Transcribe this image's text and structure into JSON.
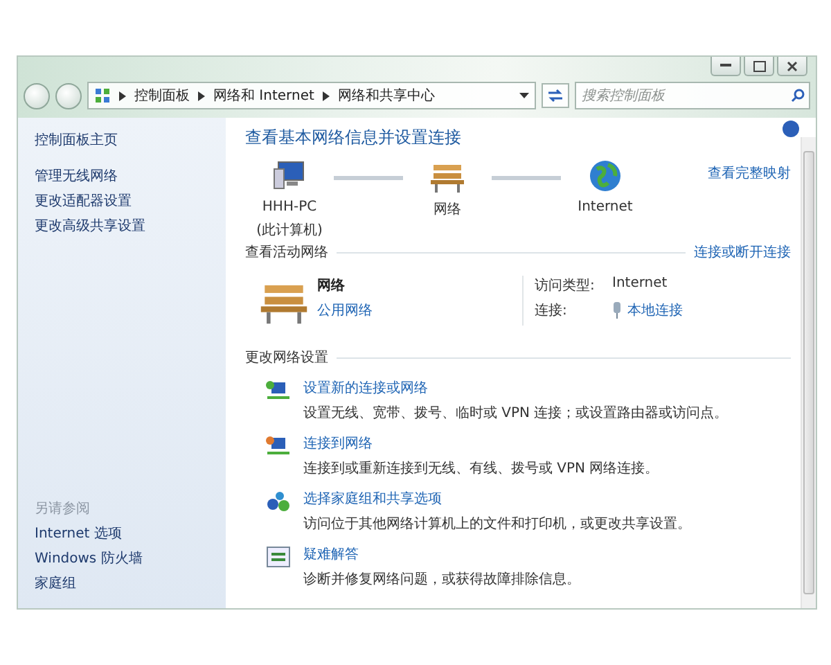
{
  "address_bar": {
    "crumbs": [
      "控制面板",
      "网络和 Internet",
      "网络和共享中心"
    ]
  },
  "search": {
    "placeholder": "搜索控制面板"
  },
  "sidebar": {
    "home": "控制面板主页",
    "links": [
      "管理无线网络",
      "更改适配器设置",
      "更改高级共享设置"
    ],
    "see_also_title": "另请参阅",
    "see_also": [
      "Internet 选项",
      "Windows 防火墙",
      "家庭组"
    ]
  },
  "main": {
    "title": "查看基本网络信息并设置连接",
    "map_link": "查看完整映射",
    "map_nodes": [
      {
        "kind": "computer",
        "label": "HHH-PC",
        "sublabel": "(此计算机)"
      },
      {
        "kind": "network",
        "label": "网络"
      },
      {
        "kind": "internet",
        "label": "Internet"
      }
    ],
    "active_section": {
      "heading": "查看活动网络",
      "link": "连接或断开连接",
      "network_name": "网络",
      "network_type": "公用网络",
      "access_label": "访问类型:",
      "access_value": "Internet",
      "connection_label": "连接:",
      "connection_value": "本地连接"
    },
    "settings_section": {
      "heading": "更改网络设置",
      "tasks": [
        {
          "kind": "new-connection",
          "title": "设置新的连接或网络",
          "description": "设置无线、宽带、拨号、临时或 VPN 连接；或设置路由器或访问点。"
        },
        {
          "kind": "connect",
          "title": "连接到网络",
          "description": "连接到或重新连接到无线、有线、拨号或 VPN 网络连接。"
        },
        {
          "kind": "homegroup",
          "title": "选择家庭组和共享选项",
          "description": "访问位于其他网络计算机上的文件和打印机，或更改共享设置。"
        },
        {
          "kind": "troubleshoot",
          "title": "疑难解答",
          "description": "诊断并修复网络问题，或获得故障排除信息。"
        }
      ]
    }
  }
}
